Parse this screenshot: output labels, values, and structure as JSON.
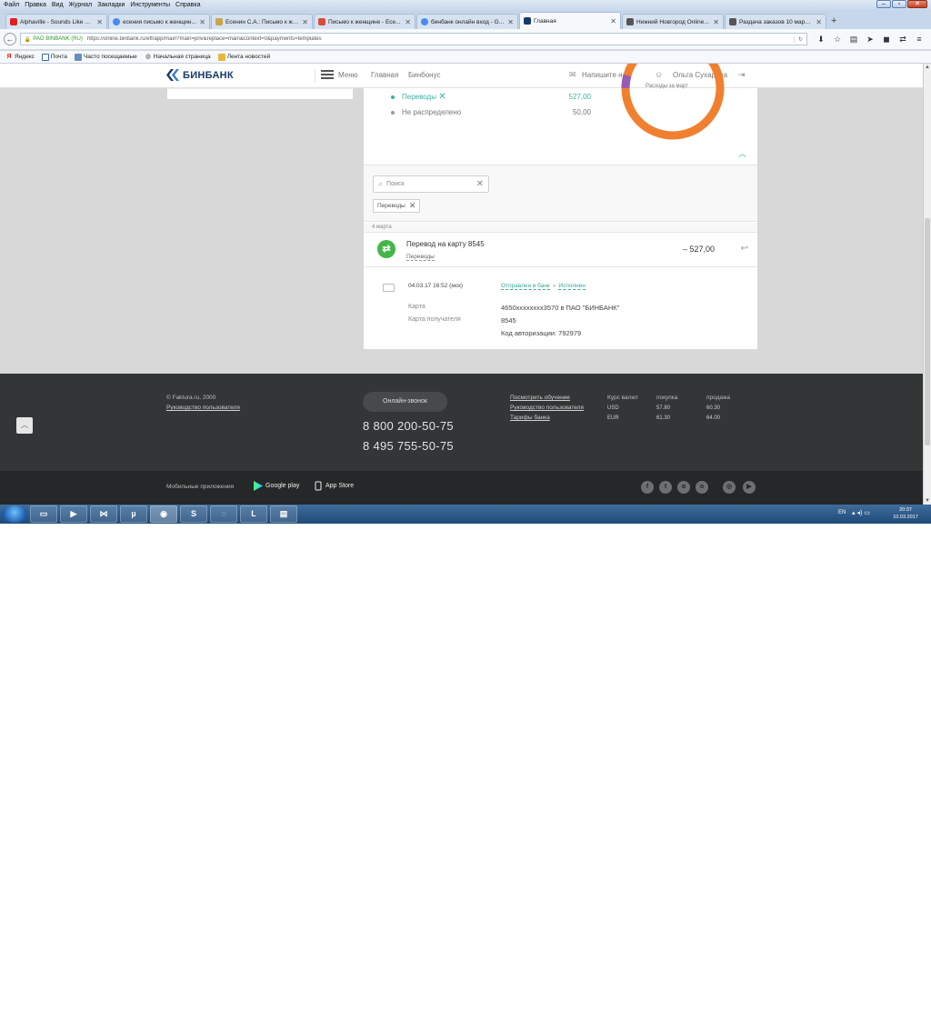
{
  "browser": {
    "menu": [
      "Файл",
      "Правка",
      "Вид",
      "Журнал",
      "Закладки",
      "Инструменты",
      "Справка"
    ],
    "tabs": [
      {
        "label": "Alphaville - Sounds Like A ...",
        "icon": "youtube-icon",
        "color": "#e02020"
      },
      {
        "label": "есения письмо к женщин...",
        "icon": "google-icon",
        "color": "#4a8af4"
      },
      {
        "label": "Есенин С.А.: Письмо к же...",
        "icon": "book-icon",
        "color": "#c9a64a"
      },
      {
        "label": "Письмо к женщине - Есе...",
        "icon": "page-icon",
        "color": "#d94b3b"
      },
      {
        "label": "бинбанк онлайн вход - G...",
        "icon": "google-icon",
        "color": "#4a8af4"
      },
      {
        "label": "Главная",
        "icon": "binbank-icon",
        "color": "#17396a",
        "active": true
      },
      {
        "label": "Нижний Новгород Online...",
        "icon": "site-icon",
        "color": "#555"
      },
      {
        "label": "Раздача заказов 10 марта...",
        "icon": "site-icon",
        "color": "#555"
      }
    ],
    "identity": "PAO BINBANK (RU)",
    "url": "https://online.binbank.ru/eff/app/main?main=priv&replace=main&context=0&payments=templates",
    "bookmarks": [
      {
        "label": "Яндекс",
        "icon": "yandex-icon"
      },
      {
        "label": "Почта",
        "icon": "mail-icon"
      },
      {
        "label": "Часто посещаемые",
        "icon": "folder-icon"
      },
      {
        "label": "Начальная страница",
        "icon": "globe-icon"
      },
      {
        "label": "Лента новостей",
        "icon": "rss-folder-icon"
      }
    ]
  },
  "header": {
    "logo": "БИНБАНК",
    "menu": "Меню",
    "home": "Главная",
    "bonus": "Бинбонус",
    "write": "Напишите нам",
    "user": "Ольга Сухарева"
  },
  "summary": {
    "donut_caption": "Расходы за март",
    "rows": [
      {
        "label": "Переводы",
        "value": "527,00",
        "color": "#3bb0a4"
      },
      {
        "label": "Не распределено",
        "value": "50,00",
        "color": "#999999"
      }
    ],
    "donut_colors": [
      "#f08030",
      "#9b59b6"
    ]
  },
  "filter": {
    "search_placeholder": "Поиск",
    "chip": "Переводы"
  },
  "operation": {
    "date": "4 марта",
    "title": "Перевод на карту 8545",
    "category": "Переводы",
    "amount": "– 527,00",
    "datetime": "04.03.17 16:52 (мск)",
    "status_sent": "Отправлен в банк",
    "status_done": "Исполнен",
    "card_label": "Карта",
    "card_value": "4650xxxxxxxx3570 в ПАО \"БИНБАНК\"",
    "recipient_label": "Карта получателя",
    "recipient_value": "8545",
    "auth_code": "Код авторизации: 792979"
  },
  "footer": {
    "copyright": "© Faktura.ru, 2000",
    "guide": "Руководство пользователя",
    "call_button": "Онлайн-звонок",
    "phone1": "8 800 200-50-75",
    "phone2": "8 495 755-50-75",
    "links": [
      "Посмотреть обучение",
      "Руководство пользователя",
      "Тарифы банка"
    ],
    "rates_title": "Курс валют",
    "buy": "покупка",
    "sell": "продажа",
    "rates": [
      {
        "cur": "USD",
        "buy": "57.80",
        "sell": "60.30"
      },
      {
        "cur": "EUR",
        "buy": "61.30",
        "sell": "64.00"
      }
    ],
    "apps_label": "Мобильные приложения",
    "google_play": "Google play",
    "app_store": "App Store"
  },
  "taskbar": {
    "lang": "EN",
    "time": "20:37",
    "date": "10.03.2017"
  }
}
